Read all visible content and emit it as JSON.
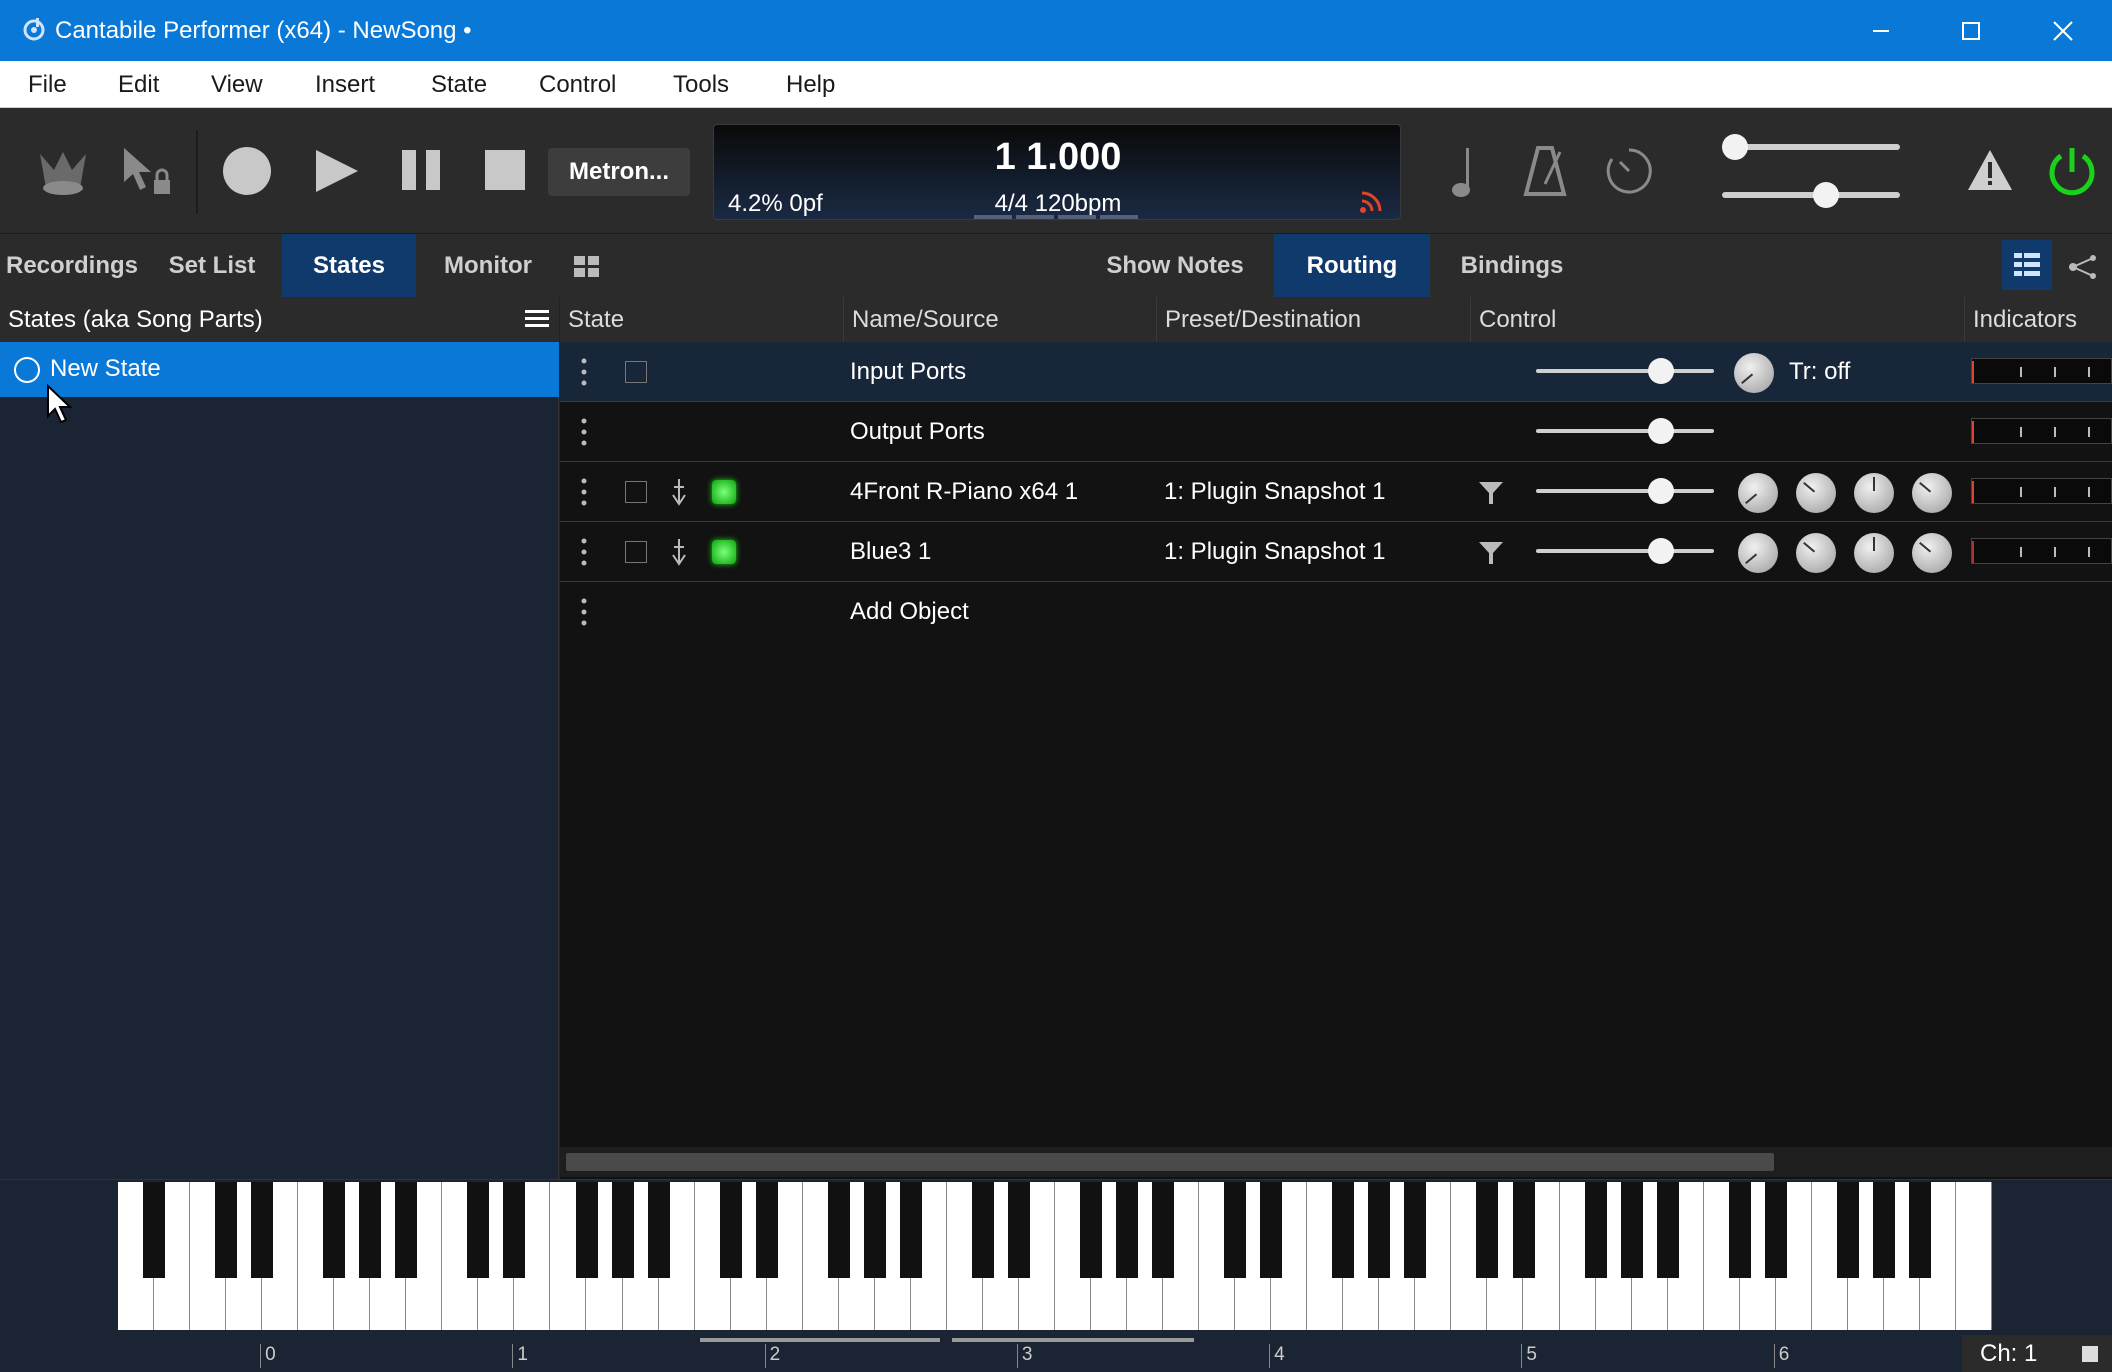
{
  "window": {
    "title": "Cantabile Performer (x64) - NewSong •",
    "controls": [
      "minimize-icon",
      "maximize-icon",
      "close-icon"
    ]
  },
  "menu": [
    "File",
    "Edit",
    "View",
    "Insert",
    "State",
    "Control",
    "Tools",
    "Help"
  ],
  "toolbar": {
    "metronome_label": "Metron...",
    "transport": {
      "position": "1 1.000",
      "load": "4.2%  0pf",
      "tempo": "4/4 120bpm"
    },
    "sliders": [
      0.0,
      0.6
    ],
    "icons": [
      "spotlight-icon",
      "pointer-lock-icon",
      "record-icon",
      "play-icon",
      "pause-icon",
      "stop-icon",
      "note-icon",
      "metronome-icon",
      "clock-icon",
      "warning-icon",
      "power-icon"
    ]
  },
  "left_tabs": [
    "Recordings",
    "Set List",
    "States",
    "Monitor"
  ],
  "right_tabs": [
    "Show Notes",
    "Routing",
    "Bindings"
  ],
  "states_panel": {
    "title": "States (aka Song Parts)",
    "items": [
      "New State"
    ]
  },
  "grid": {
    "columns": [
      "State",
      "Name/Source",
      "Preset/Destination",
      "Control",
      "Indicators"
    ],
    "rows": [
      {
        "name": "Input Ports",
        "preset": "",
        "gain": 0.74,
        "extra": "Tr: off",
        "selected": true
      },
      {
        "name": "Output Ports",
        "preset": "",
        "gain": 0.74,
        "extra": "",
        "selected": false
      },
      {
        "name": "4Front R-Piano x64 1",
        "preset": "1: Plugin Snapshot 1",
        "gain": 0.74,
        "extra": "",
        "selected": false
      },
      {
        "name": "Blue3 1",
        "preset": "1: Plugin Snapshot 1",
        "gain": 0.74,
        "extra": "",
        "selected": false
      },
      {
        "name": "Add Object",
        "preset": "",
        "extra": "",
        "selected": false
      }
    ]
  },
  "keyboard": {
    "octave_labels": [
      "0",
      "1",
      "2",
      "3",
      "4",
      "5",
      "6"
    ],
    "channel": "Ch: 1"
  },
  "colors": {
    "accent": "#0a78d7",
    "tab_active": "#0f3a6b",
    "led_green": "#19d219",
    "power_green": "#19d219"
  }
}
